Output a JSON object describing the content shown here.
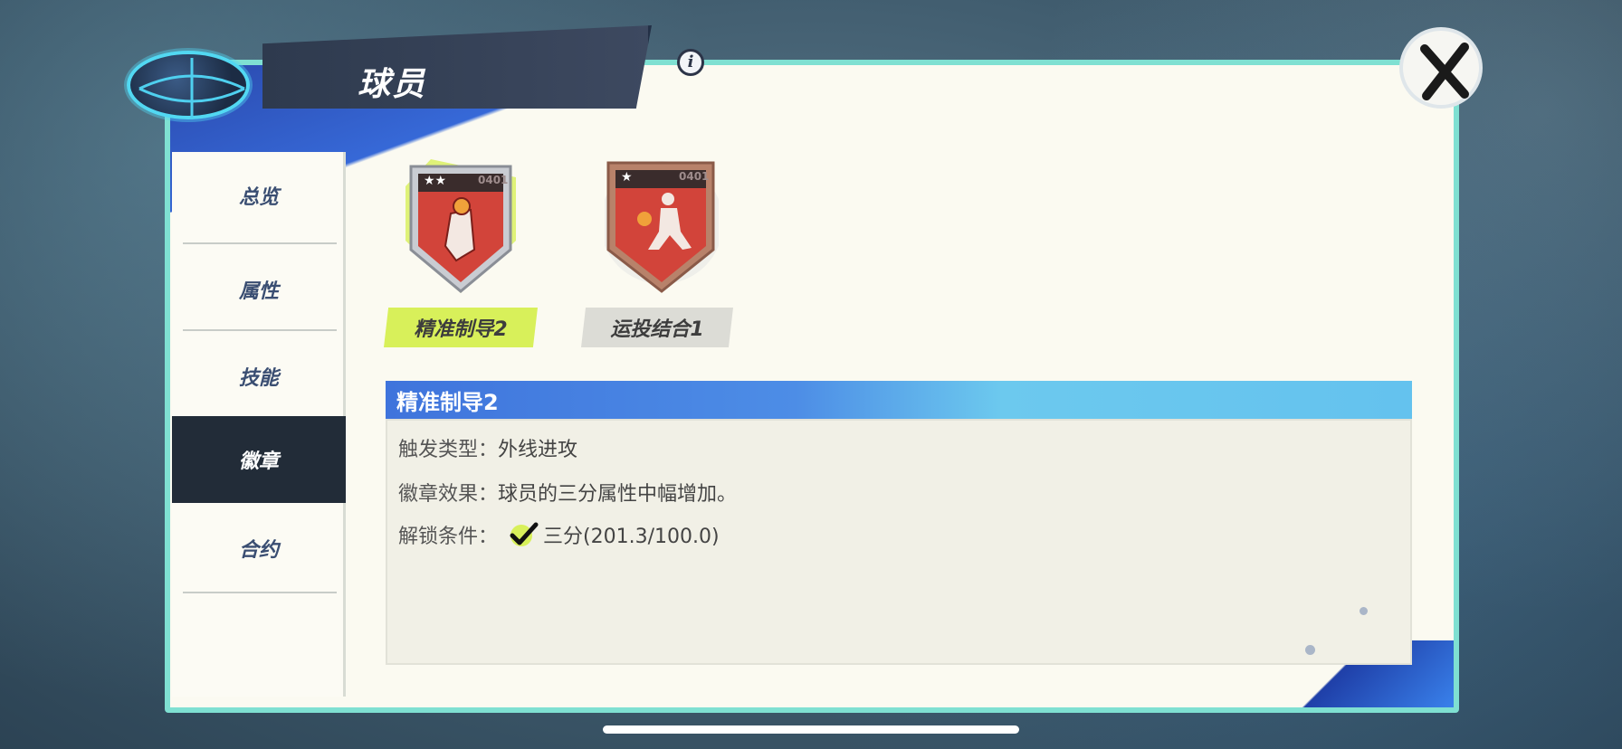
{
  "header": {
    "title": "球员"
  },
  "sidebar": {
    "items": [
      {
        "label": "总览"
      },
      {
        "label": "属性"
      },
      {
        "label": "技能"
      },
      {
        "label": "徽章"
      },
      {
        "label": "合约"
      }
    ],
    "active": "徽章"
  },
  "badges": [
    {
      "label": "精准制导2",
      "code": "0401",
      "stars": "★★",
      "selected": true
    },
    {
      "label": "运投结合1",
      "code": "0401",
      "stars": "★",
      "selected": false
    }
  ],
  "detail": {
    "title": "精准制导2",
    "trigger_key": "触发类型：",
    "trigger_val": "外线进攻",
    "effect_key": "徽章效果：",
    "effect_val": "球员的三分属性中幅增加。",
    "unlock_key": "解锁条件：",
    "unlock_val": "三分(201.3/100.0)"
  },
  "colors": {
    "accent_green": "#d8f05a",
    "header_blue": "#3f74dc",
    "badge_red": "#d2443a",
    "sidebar_active": "#222c38"
  }
}
